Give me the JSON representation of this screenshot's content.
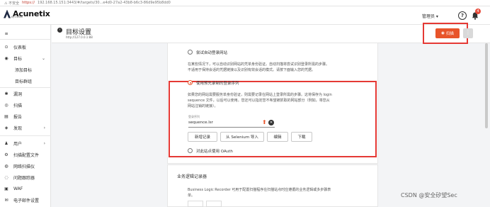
{
  "browser": {
    "security_label": "⚠ 不安全",
    "protocol": "https://",
    "url": "192.168.15.151:3443/#/targets/30...e4d0-27a2-43b8-b6c3-86d9e95b8dd0"
  },
  "app": {
    "logo_text": "Acunetix",
    "logo_sub": "by Invicti",
    "user_menu": "管理员 ▾",
    "notification_count": "4"
  },
  "sidebar": {
    "items": [
      {
        "icon": "≡",
        "label": ""
      },
      {
        "icon": "⊙",
        "label": "仪表板"
      },
      {
        "icon": "◉",
        "label": "目标",
        "arrow": "⌄"
      },
      {
        "label": "添加目标"
      },
      {
        "label": "目标群组"
      },
      {
        "icon": "✱",
        "label": "漏洞"
      },
      {
        "icon": "◎",
        "label": "扫描"
      },
      {
        "icon": "▤",
        "label": "报告"
      },
      {
        "icon": "◈",
        "label": "发现",
        "arrow": "›"
      },
      {
        "icon": "♟",
        "label": "用户",
        "arrow": "›"
      },
      {
        "icon": "⚙",
        "label": "扫描配置文件"
      },
      {
        "icon": "◍",
        "label": "网络扫描仪"
      },
      {
        "icon": "◌",
        "label": "问题跟踪器"
      },
      {
        "icon": "▣",
        "label": "WAF"
      },
      {
        "icon": "✉",
        "label": "电子邮件设置"
      }
    ]
  },
  "header": {
    "title": "目标设置",
    "subtitle": "http://127.0.0.1:88",
    "scan_button": "扫描",
    "more_button": "⋮"
  },
  "login": {
    "option_auto": "尝试自动登录网站",
    "auto_desc_1": "在某些情况下，可以自动识别网站的凭单身份验证。自动扫描将尝试识别登录所需的步骤。",
    "auto_desc_2": "不适用于保持会话的凭据链接以及识别有效会话的模式。请按下面输入您的凭据。",
    "option_sequence": "使用预先录制的登录序列",
    "seq_desc_1": "如果您的网站需要服务单身份验证，则需要记录在网站上登录所需的步骤。这将保存为 login",
    "seq_desc_2": "sequence 文件，以后可以使用。您还可以指定您不希望被抓取的网站部分（例如，将您从",
    "seq_desc_3": "网站注销的链接）。",
    "file_label": "登录序列",
    "file_value": "sequence.lsr",
    "btn_new": "新增记录",
    "btn_selenium": "从 Selenium 导入",
    "btn_edit": "编辑",
    "btn_download": "下载",
    "option_oauth": "对此站点使用 OAuth"
  },
  "business": {
    "title": "业务逻辑记录器",
    "desc_1": "Business Logic Recorder 可用于配置扫描程序在扫描站点时应遵循的业务逻辑或多步骤表",
    "desc_2": "单。"
  },
  "watermark": "CSDN @安全矽望Sec"
}
